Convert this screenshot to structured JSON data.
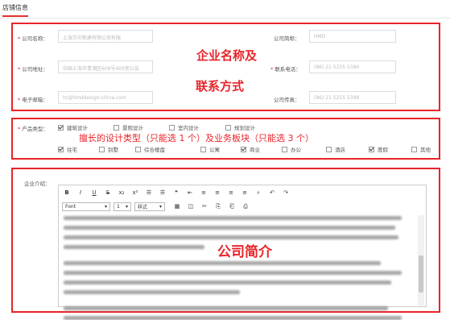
{
  "tab": {
    "label": "店铺信息"
  },
  "contact": {
    "company_name": {
      "label": "公司名称：",
      "value": "上海万中新建有限公司有限"
    },
    "company_short": {
      "label": "公司简称：",
      "value": "HMD"
    },
    "address": {
      "label": "公司地址：",
      "value": "中国上海市青浦区609号409室公告"
    },
    "phone": {
      "label": "联系电话：",
      "value": "(86) 21 5255 5384"
    },
    "email": {
      "label": "电子邮箱：",
      "value": "hr@hmddesign-china.com"
    },
    "fax": {
      "label": "公司传真：",
      "value": "(86) 21 5255 5398"
    },
    "annotation_line1": "企业名称及",
    "annotation_line2": "联系方式"
  },
  "product_types": {
    "label": "产品类型：",
    "annotation": "擅长的设计类型（只能选 1 个）及业务板块（只能选 3 个）",
    "row1": [
      {
        "label": "建筑设计",
        "checked": true
      },
      {
        "label": "景观设计",
        "checked": false
      },
      {
        "label": "室内设计",
        "checked": false
      },
      {
        "label": "规划设计",
        "checked": false
      }
    ],
    "row2": [
      {
        "label": "住宅",
        "checked": true
      },
      {
        "label": "别墅",
        "checked": false
      },
      {
        "label": "综合楼盘",
        "checked": false
      },
      {
        "label": "公寓",
        "checked": false
      },
      {
        "label": "商业",
        "checked": true
      },
      {
        "label": "办公",
        "checked": false
      },
      {
        "label": "酒店",
        "checked": false
      },
      {
        "label": "度假",
        "checked": true
      },
      {
        "label": "其他",
        "checked": false
      }
    ]
  },
  "intro": {
    "label": "企业介绍：",
    "annotation": "公司简介",
    "toolbar1": [
      "B",
      "I",
      "U",
      "S",
      "x₂",
      "x²",
      "☰",
      "☰",
      "❝",
      "⇤",
      "≡",
      "≡",
      "≡",
      "≡",
      "⌕",
      "↶",
      "↷"
    ],
    "font_select": "Font",
    "size_select": "1",
    "style_select": "样式",
    "toolbar2": [
      "▦",
      "◫",
      "✂",
      "⎘",
      "⎗",
      "⎙"
    ]
  }
}
